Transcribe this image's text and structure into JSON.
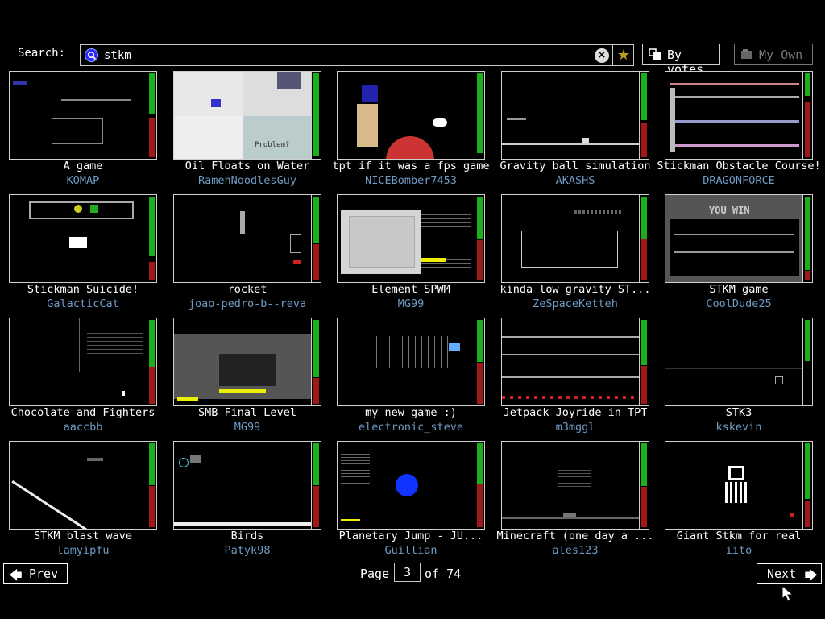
{
  "search": {
    "label": "Search:",
    "value": "stkm"
  },
  "buttons": {
    "sort_label": "By votes",
    "own_label": "My Own"
  },
  "saves": [
    {
      "title": "A game",
      "author": "KOMAP",
      "up": 0.47,
      "down": 0.46
    },
    {
      "title": "Oil Floats on Water",
      "author": "RamenNoodlesGuy",
      "up": 0.97,
      "down": 0.0
    },
    {
      "title": "tpt if it was a fps game",
      "author": "NICEBomber7453",
      "up": 0.93,
      "down": 0.0
    },
    {
      "title": "Gravity ball simulation",
      "author": "AKASHS",
      "up": 0.55,
      "down": 0.4
    },
    {
      "title": "Stickman Obstacle Course!",
      "author": "DRAGONFORCE",
      "up": 0.26,
      "down": 0.64
    },
    {
      "title": "Stickman Suicide!",
      "author": "GalacticCat",
      "up": 0.7,
      "down": 0.22
    },
    {
      "title": "rocket",
      "author": "joao-pedro-b--reva",
      "up": 0.55,
      "down": 0.42
    },
    {
      "title": "Element SPWM",
      "author": "MG99",
      "up": 0.5,
      "down": 0.47
    },
    {
      "title": "kinda low gravity ST...",
      "author": "ZeSpaceKetteh",
      "up": 0.49,
      "down": 0.48
    },
    {
      "title": "STKM game",
      "author": "CoolDude25",
      "up": 0.86,
      "down": 0.11
    },
    {
      "title": "Chocolate and Fighters",
      "author": "aaccbb",
      "up": 0.55,
      "down": 0.43
    },
    {
      "title": "SMB Final Level",
      "author": "MG99",
      "up": 0.67,
      "down": 0.3
    },
    {
      "title": "my new game :)",
      "author": "electronic_steve",
      "up": 0.49,
      "down": 0.48
    },
    {
      "title": "Jetpack Joyride in TPT",
      "author": "m3mggl",
      "up": 0.53,
      "down": 0.44
    },
    {
      "title": "STK3",
      "author": "kskevin",
      "up": 0.48,
      "down": 0.0
    },
    {
      "title": "STKM blast wave",
      "author": "lamyipfu",
      "up": 0.49,
      "down": 0.48
    },
    {
      "title": "Birds",
      "author": "Patyk98",
      "up": 0.49,
      "down": 0.48
    },
    {
      "title": "Planetary Jump - JU...",
      "author": "Guillian",
      "up": 0.47,
      "down": 0.5
    },
    {
      "title": "Minecraft (one day a ...",
      "author": "ales123",
      "up": 0.5,
      "down": 0.47
    },
    {
      "title": "Giant Stkm for real",
      "author": "iito",
      "up": 0.65,
      "down": 0.31
    }
  ],
  "pagination": {
    "prev_label": "Prev",
    "next_label": "Next",
    "page_label": "Page",
    "current_page": "3",
    "of_label": "of 74"
  },
  "thumbnail_texts": {
    "you_win": "YOU WIN",
    "problem": "Problem?"
  },
  "colors": {
    "vote_up": "#1bb01b",
    "vote_down": "#a01818",
    "author": "#6e9bc4"
  }
}
